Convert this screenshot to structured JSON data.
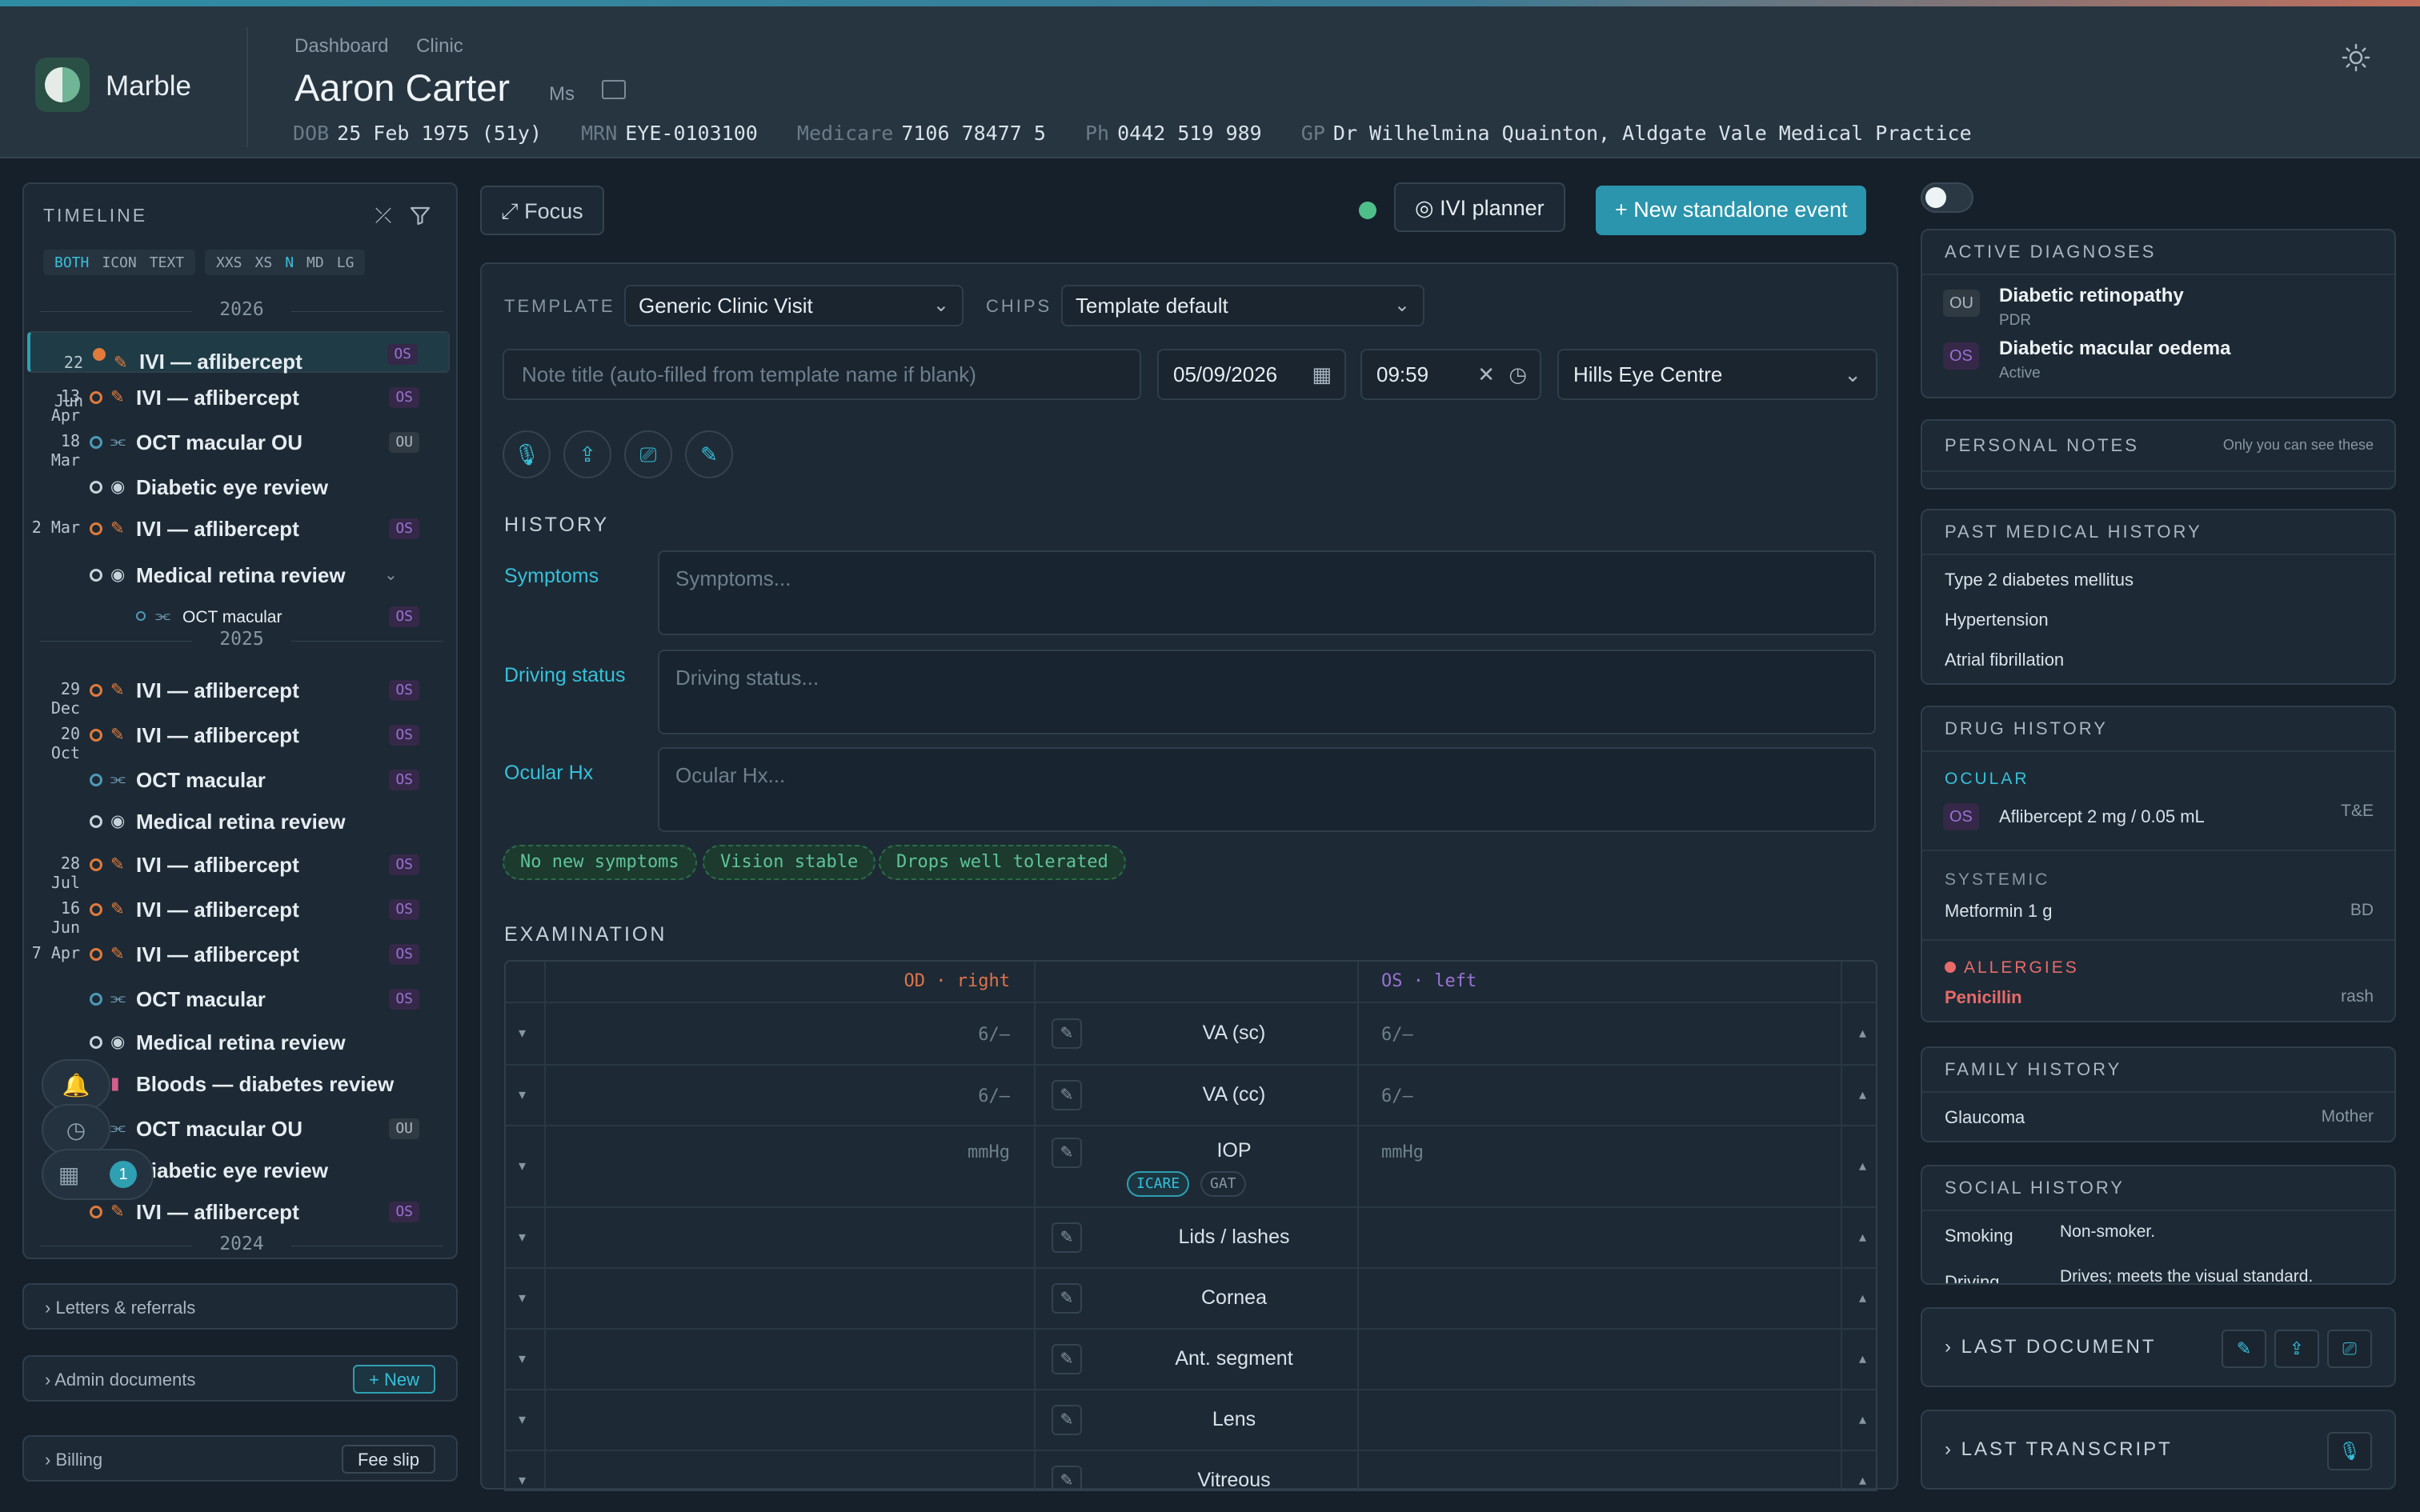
{
  "app": {
    "brand": "Marble"
  },
  "breadcrumbs": [
    "Dashboard",
    "Clinic"
  ],
  "patient": {
    "name": "Aaron Carter",
    "title": "Ms",
    "demographics": [
      {
        "key": "DOB",
        "value": "25 Feb 1975 (51y)"
      },
      {
        "key": "MRN",
        "value": "EYE-0103100"
      },
      {
        "key": "Medicare",
        "value": "7106 78477 5"
      },
      {
        "key": "Ph",
        "value": "0442 519 989"
      },
      {
        "key": "GP",
        "value": "Dr Wilhelmina Quainton, Aldgate Vale Medical Practice"
      }
    ]
  },
  "timeline": {
    "title": "TIMELINE",
    "seg1": [
      "BOTH",
      "ICON",
      "TEXT"
    ],
    "seg2": [
      "XXS",
      "XS",
      "N",
      "MD",
      "LG"
    ],
    "years": [
      "2026",
      "2025",
      "2024"
    ],
    "events": [
      {
        "date": "22 Jun",
        "icon": "syringe-icon",
        "kind": "ivi",
        "title": "IVI — aflibercept",
        "tag": "OS",
        "selected": true
      },
      {
        "date": "13 Apr",
        "icon": "syringe-icon",
        "kind": "ivi",
        "title": "IVI — aflibercept",
        "tag": "OS"
      },
      {
        "date": "18 Mar",
        "icon": "scan-icon",
        "kind": "oct",
        "title": "OCT macular OU",
        "tag": "OU"
      },
      {
        "date": "",
        "icon": "eye-icon",
        "kind": "review",
        "title": "Diabetic eye review",
        "tag": ""
      },
      {
        "date": "2 Mar",
        "icon": "syringe-icon",
        "kind": "ivi",
        "title": "IVI — aflibercept",
        "tag": "OS"
      },
      {
        "date": "",
        "icon": "eye-icon",
        "kind": "review",
        "title": "Medical retina review",
        "tag": ""
      },
      {
        "date": "",
        "icon": "scan-icon",
        "kind": "sub",
        "title": "OCT macular",
        "tag": "OS"
      },
      {
        "date": "29 Dec",
        "icon": "syringe-icon",
        "kind": "ivi",
        "title": "IVI — aflibercept",
        "tag": "OS"
      },
      {
        "date": "20 Oct",
        "icon": "syringe-icon",
        "kind": "ivi",
        "title": "IVI — aflibercept",
        "tag": "OS"
      },
      {
        "date": "",
        "icon": "scan-icon",
        "kind": "oct",
        "title": "OCT macular",
        "tag": "OS"
      },
      {
        "date": "",
        "icon": "eye-icon",
        "kind": "review",
        "title": "Medical retina review",
        "tag": ""
      },
      {
        "date": "28 Jul",
        "icon": "syringe-icon",
        "kind": "ivi",
        "title": "IVI — aflibercept",
        "tag": "OS"
      },
      {
        "date": "16 Jun",
        "icon": "syringe-icon",
        "kind": "ivi",
        "title": "IVI — aflibercept",
        "tag": "OS"
      },
      {
        "date": "7 Apr",
        "icon": "syringe-icon",
        "kind": "ivi",
        "title": "IVI — aflibercept",
        "tag": "OS"
      },
      {
        "date": "",
        "icon": "scan-icon",
        "kind": "oct",
        "title": "OCT macular",
        "tag": "OS"
      },
      {
        "date": "",
        "icon": "eye-icon",
        "kind": "review",
        "title": "Medical retina review",
        "tag": ""
      },
      {
        "date": "",
        "icon": "test-tube-icon",
        "kind": "bloods",
        "title": "Bloods — diabetes review",
        "tag": ""
      },
      {
        "date": "",
        "icon": "scan-icon",
        "kind": "oct",
        "title": "OCT macular OU",
        "tag": "OU"
      },
      {
        "date": "",
        "icon": "eye-icon",
        "kind": "review",
        "title": "Diabetic eye review",
        "tag": ""
      },
      {
        "date": "",
        "icon": "syringe-icon",
        "kind": "ivi",
        "title": "IVI — aflibercept",
        "tag": "OS"
      }
    ],
    "calendar_badge": "1"
  },
  "sections": {
    "letters": "Letters & referrals",
    "admin": "Admin documents",
    "admin_new": "+ New",
    "billing": "Billing",
    "fee_slip": "Fee slip"
  },
  "toolbar": {
    "focus": "Focus",
    "ivi_planner": "IVI planner",
    "new_event": "New standalone event"
  },
  "form": {
    "template_label": "TEMPLATE",
    "template_value": "Generic Clinic Visit",
    "chips_label": "CHIPS",
    "chips_value": "Template default",
    "note_title_placeholder": "Note title (auto-filled from template name if blank)",
    "date": "05/09/2026",
    "time": "09:59",
    "location": "Hills Eye Centre",
    "history_title": "HISTORY",
    "fields": [
      {
        "label": "Symptoms",
        "placeholder": "Symptoms..."
      },
      {
        "label": "Driving status",
        "placeholder": "Driving status..."
      },
      {
        "label": "Ocular Hx",
        "placeholder": "Ocular Hx..."
      }
    ],
    "chips": [
      "No new symptoms",
      "Vision stable",
      "Drops well tolerated"
    ],
    "exam_title": "EXAMINATION",
    "od_header": "OD · right",
    "os_header": "OS · left",
    "exam_rows": [
      {
        "name": "VA (sc)",
        "od": "6/—",
        "os": "6/—"
      },
      {
        "name": "VA (cc)",
        "od": "6/—",
        "os": "6/—"
      },
      {
        "name": "IOP",
        "od": "mmHg",
        "os": "mmHg",
        "chips": [
          "ICARE",
          "GAT"
        ]
      },
      {
        "name": "Lids / lashes",
        "od": "",
        "os": ""
      },
      {
        "name": "Cornea",
        "od": "",
        "os": ""
      },
      {
        "name": "Ant. segment",
        "od": "",
        "os": ""
      },
      {
        "name": "Lens",
        "od": "",
        "os": ""
      },
      {
        "name": "Vitreous",
        "od": "",
        "os": ""
      }
    ]
  },
  "right": {
    "active_dx_title": "ACTIVE DIAGNOSES",
    "active_dx": [
      {
        "eye": "OU",
        "name": "Diabetic retinopathy",
        "sub": "PDR"
      },
      {
        "eye": "OS",
        "name": "Diabetic macular oedema",
        "sub": "Active"
      }
    ],
    "personal_notes_title": "PERSONAL NOTES",
    "personal_notes_hint": "Only you can see these",
    "pmh_title": "PAST MEDICAL HISTORY",
    "pmh": [
      "Type 2 diabetes mellitus",
      "Hypertension",
      "Atrial fibrillation"
    ],
    "drug_title": "DRUG HISTORY",
    "ocular_label": "OCULAR",
    "ocular_drug": {
      "eye": "OS",
      "name": "Aflibercept 2 mg / 0.05 mL",
      "freq": "T&E"
    },
    "systemic_label": "SYSTEMIC",
    "systemic_drug": {
      "name": "Metformin 1 g",
      "freq": "BD"
    },
    "allergies_label": "ALLERGIES",
    "allergy": {
      "name": "Penicillin",
      "reaction": "rash"
    },
    "family_title": "FAMILY HISTORY",
    "family": {
      "name": "Glaucoma",
      "relation": "Mother"
    },
    "social_title": "SOCIAL HISTORY",
    "social": [
      {
        "k": "Smoking",
        "v": "Non-smoker."
      },
      {
        "k": "Driving",
        "v": "Drives; meets the visual standard."
      }
    ],
    "last_document": "LAST DOCUMENT",
    "last_transcript": "LAST TRANSCRIPT"
  },
  "colors": {
    "accent": "#2f9fb2",
    "od": "#e0734a",
    "os": "#9a72d2",
    "ivi": "#e07b3c",
    "danger": "#e86a6a",
    "ok": "#5fc49a"
  }
}
